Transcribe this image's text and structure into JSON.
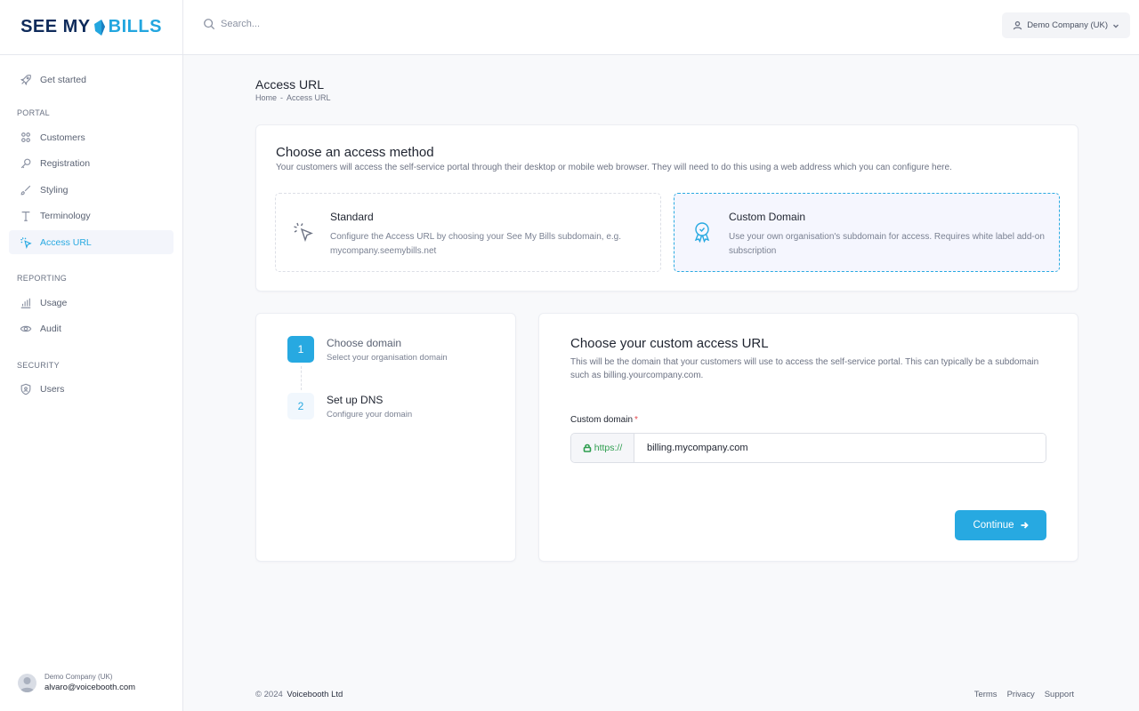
{
  "brand": {
    "logo_left": "SEE MY",
    "logo_right": "BILLS"
  },
  "search": {
    "placeholder": "Search..."
  },
  "header": {
    "company_selector": "Demo Company (UK)"
  },
  "sidebar": {
    "get_started": "Get started",
    "sections": {
      "portal": "PORTAL",
      "reporting": "REPORTING",
      "security": "SECURITY"
    },
    "portal_items": [
      "Customers",
      "Registration",
      "Styling",
      "Terminology",
      "Access URL"
    ],
    "reporting_items": [
      "Usage",
      "Audit"
    ],
    "security_items": [
      "Users"
    ],
    "user": {
      "company": "Demo Company (UK)",
      "email": "alvaro@voicebooth.com"
    }
  },
  "page": {
    "title": "Access URL",
    "breadcrumb": {
      "home": "Home",
      "separator": "-",
      "current": "Access URL"
    }
  },
  "access_method": {
    "title": "Choose an access method",
    "description": "Your customers will access the self-service portal through their desktop or mobile web browser. They will need to do this using a web address which you can configure here.",
    "options": [
      {
        "title": "Standard",
        "description": "Configure the Access URL by choosing your See My Bills subdomain, e.g. mycompany.seemybills.net",
        "icon": "cursor-click-icon",
        "selected": false
      },
      {
        "title": "Custom Domain",
        "description": "Use your own organisation's subdomain for access. Requires white label add-on subscription",
        "icon": "award-badge-icon",
        "selected": true
      }
    ]
  },
  "steps": [
    {
      "number": "1",
      "title": "Choose domain",
      "subtitle": "Select your organisation domain"
    },
    {
      "number": "2",
      "title": "Set up DNS",
      "subtitle": "Configure your domain"
    }
  ],
  "form": {
    "title": "Choose your custom access URL",
    "description": "This will be the domain that your customers will use to access the self-service portal. This can typically be a subdomain such as billing.yourcompany.com.",
    "field_label": "Custom domain",
    "required_mark": "*",
    "prefix": "https://",
    "value": "billing.mycompany.com",
    "continue_label": "Continue"
  },
  "footer": {
    "copyright": "© 2024",
    "company": "Voicebooth Ltd",
    "links": [
      "Terms",
      "Privacy",
      "Support"
    ]
  },
  "colors": {
    "accent": "#27a9e1",
    "brand_dark": "#0f2b5b",
    "success": "#2e9e4f",
    "required": "#e5484d"
  }
}
